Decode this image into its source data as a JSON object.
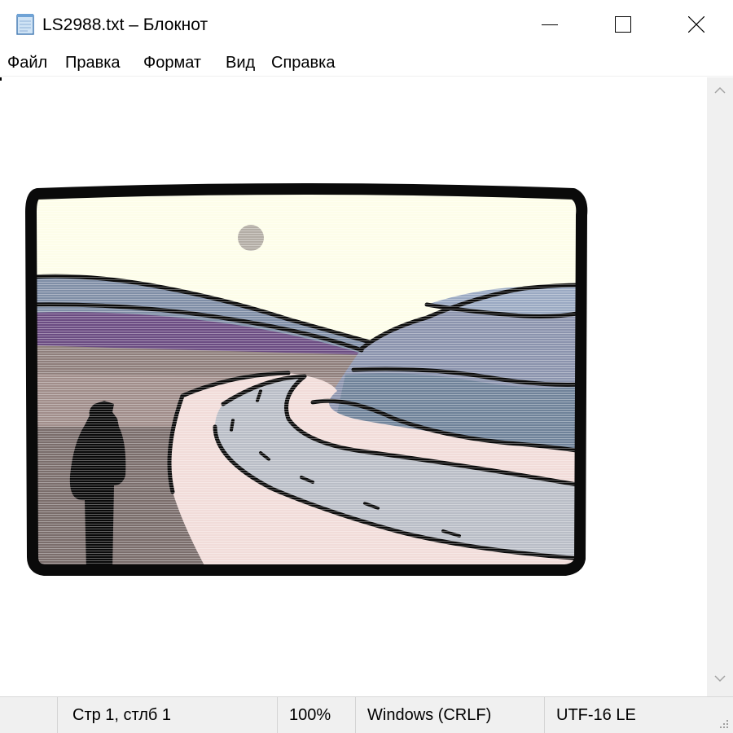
{
  "window": {
    "title": "LS2988.txt – Блокнот",
    "icon": "notepad-icon",
    "controls": {
      "minimize": "minimize-icon",
      "maximize": "maximize-icon",
      "close": "close-icon"
    }
  },
  "menu": {
    "items": [
      {
        "label": "Файл"
      },
      {
        "label": "Правка"
      },
      {
        "label": "Формат"
      },
      {
        "label": "Вид"
      },
      {
        "label": "Справка"
      }
    ]
  },
  "editor": {
    "content": "ASCII-art style picture: figure beside a winding road through hills",
    "scrollbar_icons": [
      "chevron-up-icon",
      "chevron-down-icon"
    ]
  },
  "status": {
    "position": "Стр 1, стлб 1",
    "zoom": "100%",
    "line_endings": "Windows (CRLF)",
    "encoding": "UTF-16 LE"
  },
  "colors": {
    "sky": "#fdfde9",
    "sun": "#b3ada5",
    "hill_far": "#7a8aa3",
    "hill_purple": "#6b4c82",
    "road": "#b9bdc6",
    "riverbank": "#f1dcd9",
    "field": "#8a7a78",
    "hill_blue": "#6f8299",
    "outline": "#0a0a0a"
  }
}
